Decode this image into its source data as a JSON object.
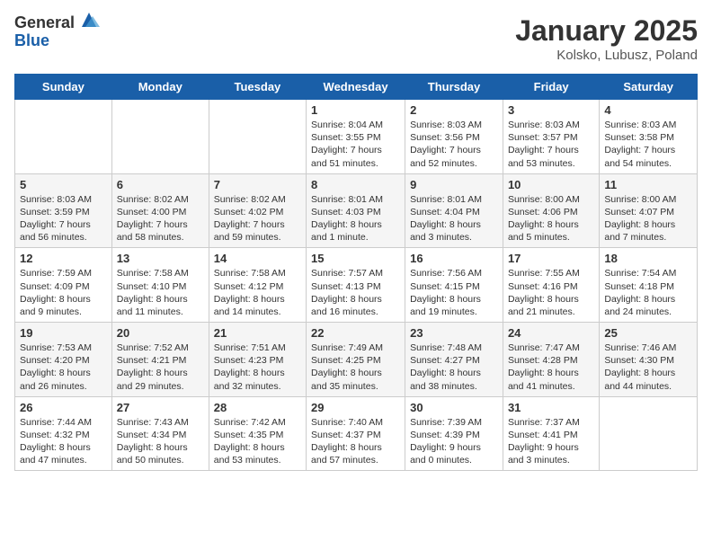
{
  "logo": {
    "general": "General",
    "blue": "Blue"
  },
  "title": "January 2025",
  "location": "Kolsko, Lubusz, Poland",
  "days_of_week": [
    "Sunday",
    "Monday",
    "Tuesday",
    "Wednesday",
    "Thursday",
    "Friday",
    "Saturday"
  ],
  "weeks": [
    [
      {
        "day": "",
        "info": ""
      },
      {
        "day": "",
        "info": ""
      },
      {
        "day": "",
        "info": ""
      },
      {
        "day": "1",
        "info": "Sunrise: 8:04 AM\nSunset: 3:55 PM\nDaylight: 7 hours and 51 minutes."
      },
      {
        "day": "2",
        "info": "Sunrise: 8:03 AM\nSunset: 3:56 PM\nDaylight: 7 hours and 52 minutes."
      },
      {
        "day": "3",
        "info": "Sunrise: 8:03 AM\nSunset: 3:57 PM\nDaylight: 7 hours and 53 minutes."
      },
      {
        "day": "4",
        "info": "Sunrise: 8:03 AM\nSunset: 3:58 PM\nDaylight: 7 hours and 54 minutes."
      }
    ],
    [
      {
        "day": "5",
        "info": "Sunrise: 8:03 AM\nSunset: 3:59 PM\nDaylight: 7 hours and 56 minutes."
      },
      {
        "day": "6",
        "info": "Sunrise: 8:02 AM\nSunset: 4:00 PM\nDaylight: 7 hours and 58 minutes."
      },
      {
        "day": "7",
        "info": "Sunrise: 8:02 AM\nSunset: 4:02 PM\nDaylight: 7 hours and 59 minutes."
      },
      {
        "day": "8",
        "info": "Sunrise: 8:01 AM\nSunset: 4:03 PM\nDaylight: 8 hours and 1 minute."
      },
      {
        "day": "9",
        "info": "Sunrise: 8:01 AM\nSunset: 4:04 PM\nDaylight: 8 hours and 3 minutes."
      },
      {
        "day": "10",
        "info": "Sunrise: 8:00 AM\nSunset: 4:06 PM\nDaylight: 8 hours and 5 minutes."
      },
      {
        "day": "11",
        "info": "Sunrise: 8:00 AM\nSunset: 4:07 PM\nDaylight: 8 hours and 7 minutes."
      }
    ],
    [
      {
        "day": "12",
        "info": "Sunrise: 7:59 AM\nSunset: 4:09 PM\nDaylight: 8 hours and 9 minutes."
      },
      {
        "day": "13",
        "info": "Sunrise: 7:58 AM\nSunset: 4:10 PM\nDaylight: 8 hours and 11 minutes."
      },
      {
        "day": "14",
        "info": "Sunrise: 7:58 AM\nSunset: 4:12 PM\nDaylight: 8 hours and 14 minutes."
      },
      {
        "day": "15",
        "info": "Sunrise: 7:57 AM\nSunset: 4:13 PM\nDaylight: 8 hours and 16 minutes."
      },
      {
        "day": "16",
        "info": "Sunrise: 7:56 AM\nSunset: 4:15 PM\nDaylight: 8 hours and 19 minutes."
      },
      {
        "day": "17",
        "info": "Sunrise: 7:55 AM\nSunset: 4:16 PM\nDaylight: 8 hours and 21 minutes."
      },
      {
        "day": "18",
        "info": "Sunrise: 7:54 AM\nSunset: 4:18 PM\nDaylight: 8 hours and 24 minutes."
      }
    ],
    [
      {
        "day": "19",
        "info": "Sunrise: 7:53 AM\nSunset: 4:20 PM\nDaylight: 8 hours and 26 minutes."
      },
      {
        "day": "20",
        "info": "Sunrise: 7:52 AM\nSunset: 4:21 PM\nDaylight: 8 hours and 29 minutes."
      },
      {
        "day": "21",
        "info": "Sunrise: 7:51 AM\nSunset: 4:23 PM\nDaylight: 8 hours and 32 minutes."
      },
      {
        "day": "22",
        "info": "Sunrise: 7:49 AM\nSunset: 4:25 PM\nDaylight: 8 hours and 35 minutes."
      },
      {
        "day": "23",
        "info": "Sunrise: 7:48 AM\nSunset: 4:27 PM\nDaylight: 8 hours and 38 minutes."
      },
      {
        "day": "24",
        "info": "Sunrise: 7:47 AM\nSunset: 4:28 PM\nDaylight: 8 hours and 41 minutes."
      },
      {
        "day": "25",
        "info": "Sunrise: 7:46 AM\nSunset: 4:30 PM\nDaylight: 8 hours and 44 minutes."
      }
    ],
    [
      {
        "day": "26",
        "info": "Sunrise: 7:44 AM\nSunset: 4:32 PM\nDaylight: 8 hours and 47 minutes."
      },
      {
        "day": "27",
        "info": "Sunrise: 7:43 AM\nSunset: 4:34 PM\nDaylight: 8 hours and 50 minutes."
      },
      {
        "day": "28",
        "info": "Sunrise: 7:42 AM\nSunset: 4:35 PM\nDaylight: 8 hours and 53 minutes."
      },
      {
        "day": "29",
        "info": "Sunrise: 7:40 AM\nSunset: 4:37 PM\nDaylight: 8 hours and 57 minutes."
      },
      {
        "day": "30",
        "info": "Sunrise: 7:39 AM\nSunset: 4:39 PM\nDaylight: 9 hours and 0 minutes."
      },
      {
        "day": "31",
        "info": "Sunrise: 7:37 AM\nSunset: 4:41 PM\nDaylight: 9 hours and 3 minutes."
      },
      {
        "day": "",
        "info": ""
      }
    ]
  ]
}
